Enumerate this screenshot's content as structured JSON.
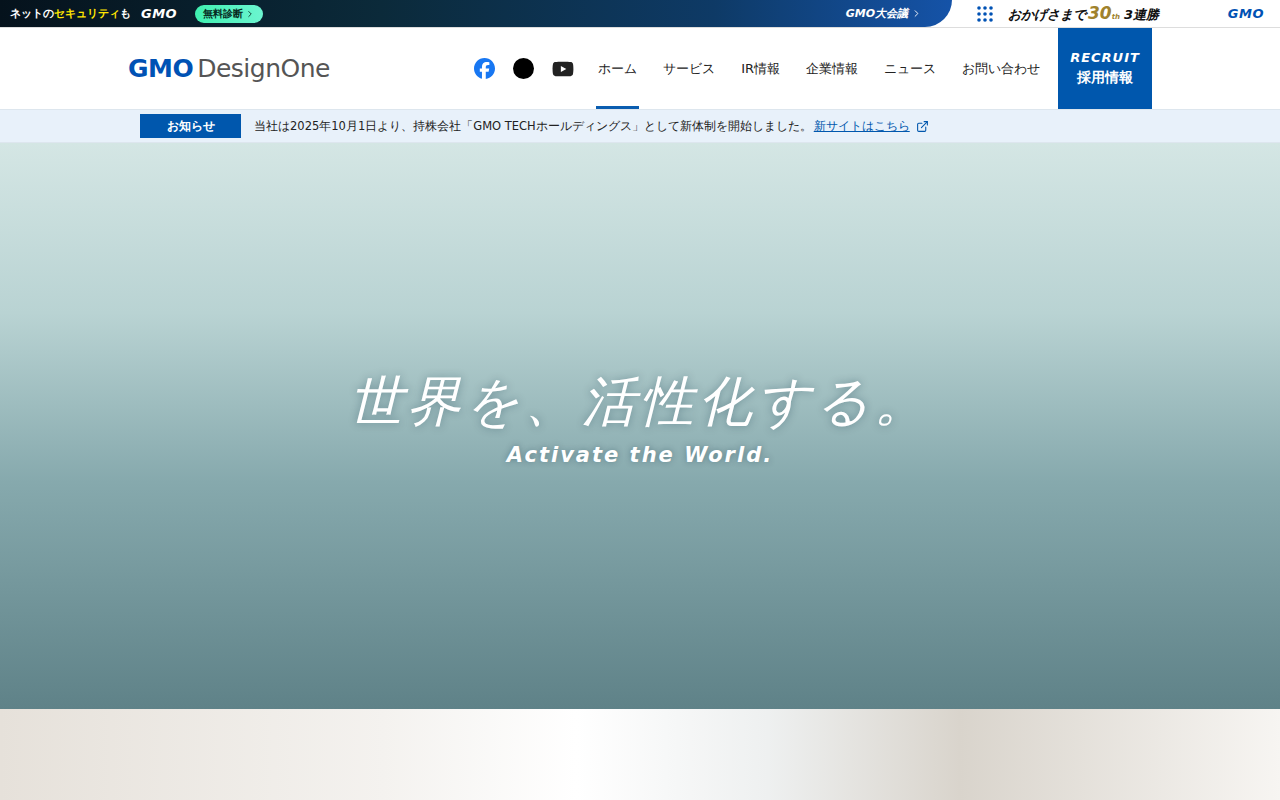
{
  "topbar": {
    "tagline": [
      {
        "text": "ネットの",
        "highlight": false
      },
      {
        "text": "セキュリティ",
        "highlight": true
      },
      {
        "text": "も",
        "highlight": false
      }
    ],
    "tagline_logo": "GMO",
    "diagnose_button": "無料診断",
    "summit_link": "GMO大会議",
    "anniversary": {
      "prefix": "おかげさまで",
      "number": "30",
      "suffix": "th",
      "wins": "3連勝",
      "logo": "GMO"
    }
  },
  "header": {
    "logo": {
      "mark": "GMO",
      "name": "DesignOne"
    },
    "nav": [
      {
        "label": "ホーム",
        "selected": true
      },
      {
        "label": "サービス",
        "selected": false
      },
      {
        "label": "IR情報",
        "selected": false
      },
      {
        "label": "企業情報",
        "selected": false
      },
      {
        "label": "ニュース",
        "selected": false
      },
      {
        "label": "お問い合わせ",
        "selected": false
      }
    ],
    "recruit": {
      "en": "RECRUIT",
      "ja": "採用情報"
    }
  },
  "notice": {
    "badge": "お知らせ",
    "text": "当社は2025年10月1日より、持株会社「GMO TECHホールディングス」として新体制を開始しました。",
    "link": "新サイトはこちら"
  },
  "hero": {
    "title": "世界を、活性化する。",
    "subtitle": "Activate the World."
  }
}
